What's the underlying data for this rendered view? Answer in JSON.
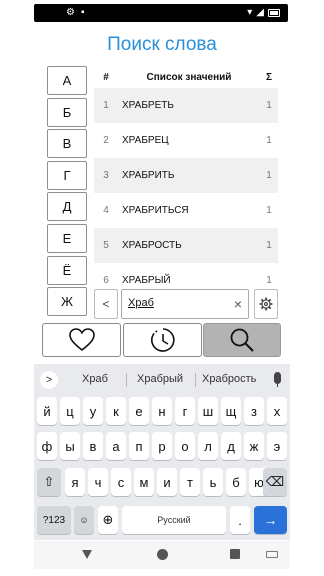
{
  "status_bar": {
    "left_icons": [
      "settings-icon",
      "sim-icon"
    ],
    "right_icons": [
      "wifi-icon",
      "signal-icon",
      "battery-icon"
    ]
  },
  "title": "Поиск слова",
  "letters": [
    "А",
    "Б",
    "В",
    "Г",
    "Д",
    "Е",
    "Ё",
    "Ж"
  ],
  "table": {
    "headers": {
      "num": "#",
      "word": "Список значений",
      "sum": "Σ"
    },
    "rows": [
      {
        "num": "1",
        "word": "ХРАБРЕТЬ",
        "count": "1"
      },
      {
        "num": "2",
        "word": "ХРАБРЕЦ",
        "count": "1"
      },
      {
        "num": "3",
        "word": "ХРАБРИТЬ",
        "count": "1"
      },
      {
        "num": "4",
        "word": "ХРАБРИТЬСЯ",
        "count": "1"
      },
      {
        "num": "5",
        "word": "ХРАБРОСТЬ",
        "count": "1"
      },
      {
        "num": "6",
        "word": "ХРАБРЫЙ",
        "count": "1"
      }
    ]
  },
  "search": {
    "back_label": "<",
    "value": "Храб",
    "clear_label": "×"
  },
  "actions": {
    "favorite": "heart-icon",
    "history": "history-icon",
    "search": "magnifier-icon"
  },
  "keyboard": {
    "suggestions": [
      "Храб",
      "Храбрый",
      "Храбрость"
    ],
    "expand_label": ">",
    "row1": [
      "й",
      "ц",
      "у",
      "к",
      "е",
      "н",
      "г",
      "ш",
      "щ",
      "з",
      "х"
    ],
    "row2": [
      "ф",
      "ы",
      "в",
      "а",
      "п",
      "р",
      "о",
      "л",
      "д",
      "ж",
      "э"
    ],
    "row3": [
      "я",
      "ч",
      "с",
      "м",
      "и",
      "т",
      "ь",
      "б",
      "ю"
    ],
    "shift": "⇧",
    "backspace": "⌫",
    "symbols": "?123",
    "emoji": "☺",
    "comma": ",",
    "globe": "⊕",
    "space": "Русский",
    "period": ".",
    "enter": "→"
  }
}
